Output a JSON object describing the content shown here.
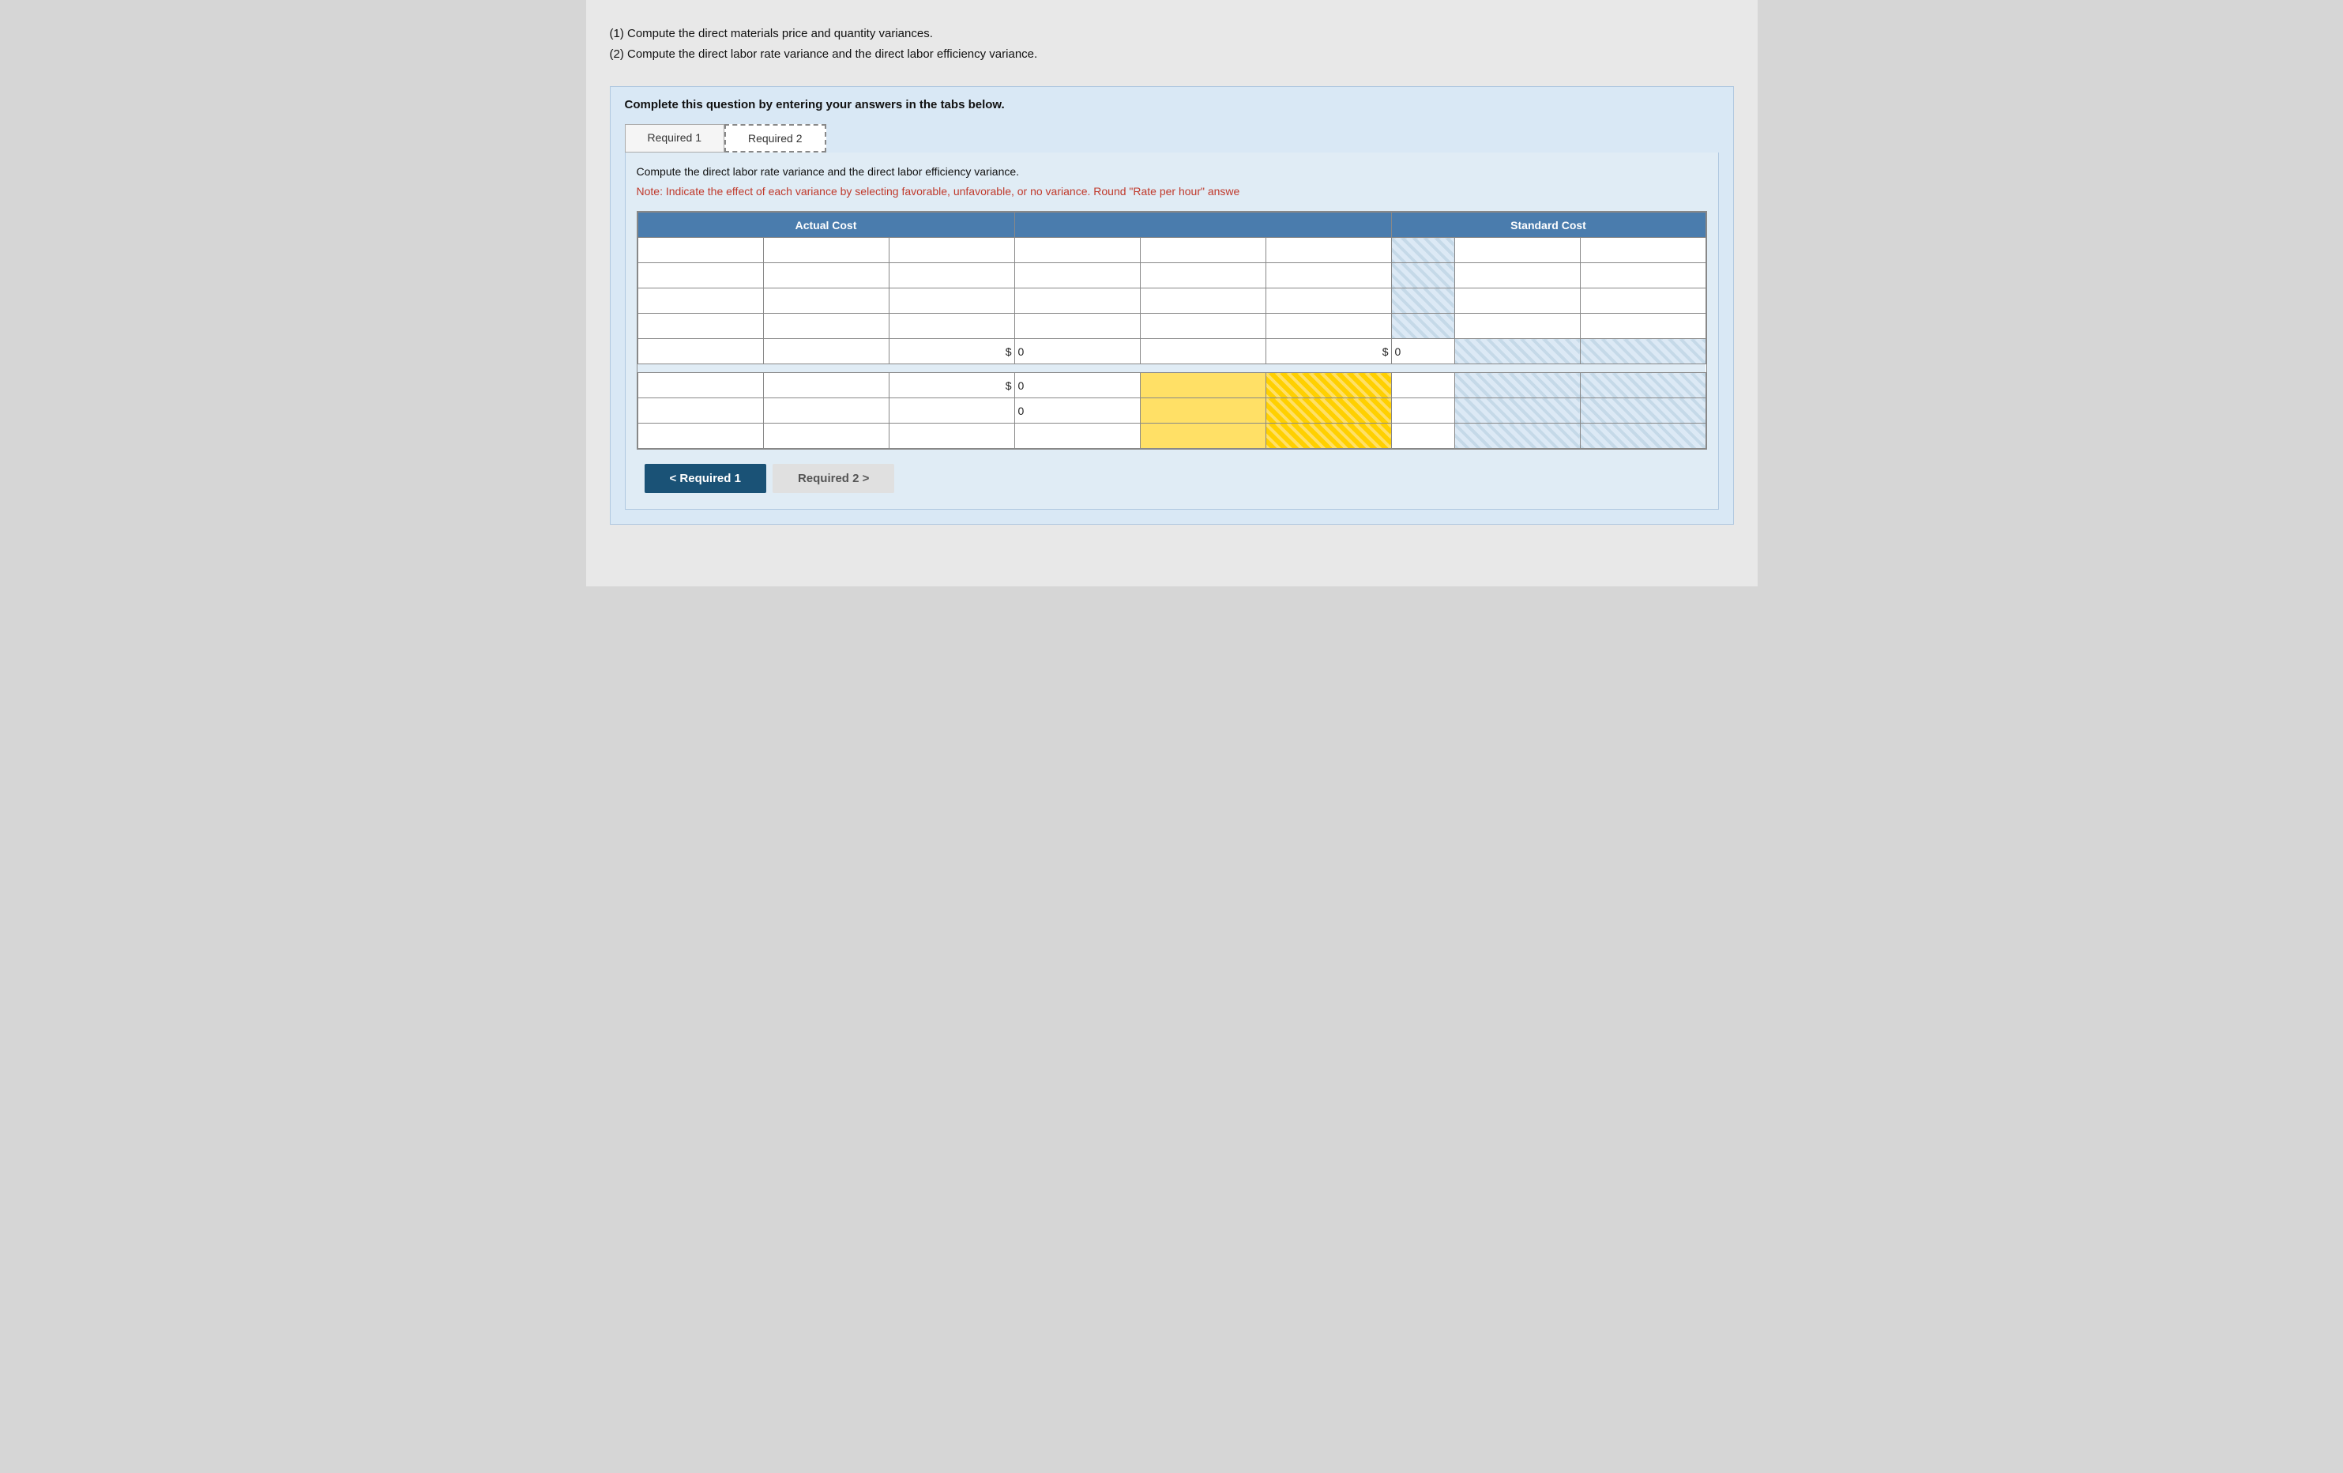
{
  "instructions": {
    "line1": "(1) Compute the direct materials price and quantity variances.",
    "line2": "(2) Compute the direct labor rate variance and the direct labor efficiency variance."
  },
  "complete_box": {
    "title": "Complete this question by entering your answers in the tabs below."
  },
  "tabs": [
    {
      "id": "req1",
      "label": "Required 1",
      "active": false
    },
    {
      "id": "req2",
      "label": "Required 2",
      "active": true
    }
  ],
  "content": {
    "description": "Compute the direct labor rate variance and the direct labor efficiency variance.",
    "note": "Note: Indicate the effect of each variance by selecting favorable, unfavorable, or no variance. Round \"Rate per hour\" answe"
  },
  "table": {
    "header_left": "Actual Cost",
    "header_right": "Standard Cost",
    "rows_actual": [
      {
        "col1": "",
        "col2": "",
        "col3": ""
      },
      {
        "col1": "",
        "col2": "",
        "col3": ""
      },
      {
        "col1": "",
        "col2": "",
        "col3": ""
      },
      {
        "col1": "",
        "col2": "",
        "col3": ""
      }
    ],
    "rows_middle": [
      {
        "col1": "",
        "col2": "",
        "col3": ""
      },
      {
        "col1": "",
        "col2": "",
        "col3": ""
      },
      {
        "col1": "",
        "col2": "",
        "col3": ""
      },
      {
        "col1": "",
        "col2": "",
        "col3": ""
      }
    ],
    "rows_standard": [
      {
        "col1": "",
        "col2": "",
        "col3": ""
      },
      {
        "col1": "",
        "col2": "",
        "col3": ""
      },
      {
        "col1": "",
        "col2": "",
        "col3": ""
      },
      {
        "col1": "",
        "col2": "",
        "col3": ""
      }
    ],
    "total_left_currency": "$",
    "total_left_value": "0",
    "total_mid_currency": "$",
    "total_mid_value": "0",
    "variance_rows": [
      {
        "label": "$",
        "value": "0",
        "yellow_cells": 2
      },
      {
        "label": "",
        "value": "0",
        "yellow_cells": 2
      },
      {
        "label": "",
        "value": "",
        "yellow_cells": 2
      }
    ]
  },
  "navigation": {
    "back_label": "< Required 1",
    "forward_label": "Required 2 >"
  }
}
